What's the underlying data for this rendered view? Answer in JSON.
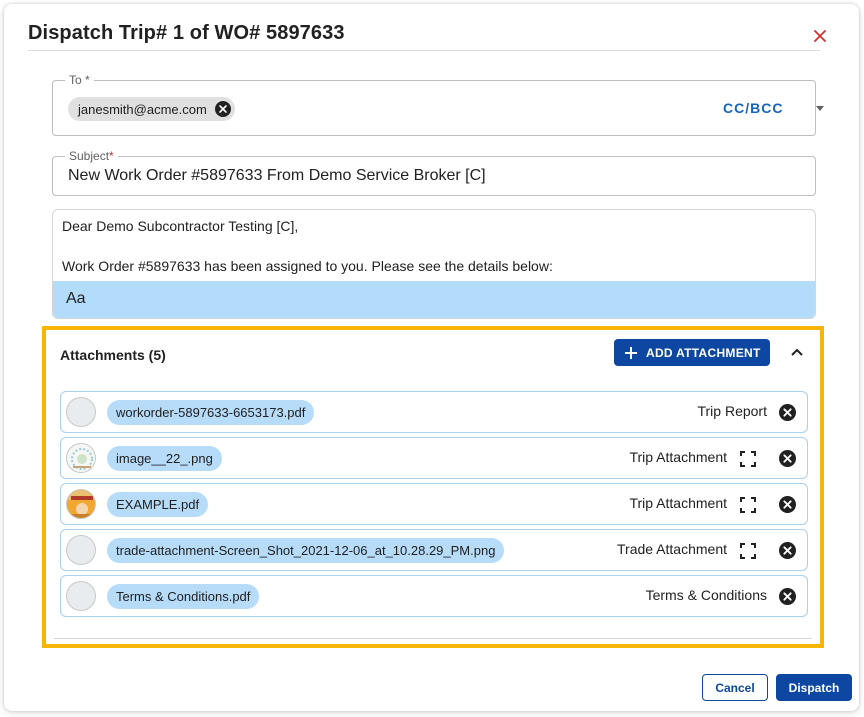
{
  "dialog": {
    "title": "Dispatch Trip# 1 of WO# 5897633",
    "close_icon": "close-icon"
  },
  "to_field": {
    "label": "To *",
    "recipients": [
      "janesmith@acme.com"
    ],
    "cc_bcc_label": "CC/BCC"
  },
  "subject_field": {
    "label": "Subject",
    "required_marker": "*",
    "value": "New Work Order #5897633 From Demo Service Broker [C]"
  },
  "body": {
    "lines": [
      "Dear Demo Subcontractor Testing [C],",
      "Work Order #5897633 has been assigned to you. Please see the details below:"
    ],
    "format_button": "Aa"
  },
  "attachments": {
    "title": "Attachments (5)",
    "add_button": "ADD ATTACHMENT",
    "items": [
      {
        "file": "workorder-5897633-6653173.pdf",
        "type": "Trip Report",
        "has_expand": false,
        "thumb": "blank"
      },
      {
        "file": "image__22_.png",
        "type": "Trip Attachment",
        "has_expand": true,
        "thumb": "image"
      },
      {
        "file": "EXAMPLE.pdf",
        "type": "Trip Attachment",
        "has_expand": true,
        "thumb": "photo"
      },
      {
        "file": "trade-attachment-Screen_Shot_2021-12-06_at_10.28.29_PM.png",
        "type": "Trade Attachment",
        "has_expand": true,
        "thumb": "blank"
      },
      {
        "file": "Terms & Conditions.pdf",
        "type": "Terms & Conditions",
        "has_expand": false,
        "thumb": "blank"
      }
    ]
  },
  "footer": {
    "cancel_label": "Cancel",
    "dispatch_label": "Dispatch"
  },
  "colors": {
    "primary": "#0d47a1",
    "highlight_border": "#f7b500",
    "chip_blue": "#b6dcfa",
    "close_red": "#d32f2f"
  }
}
